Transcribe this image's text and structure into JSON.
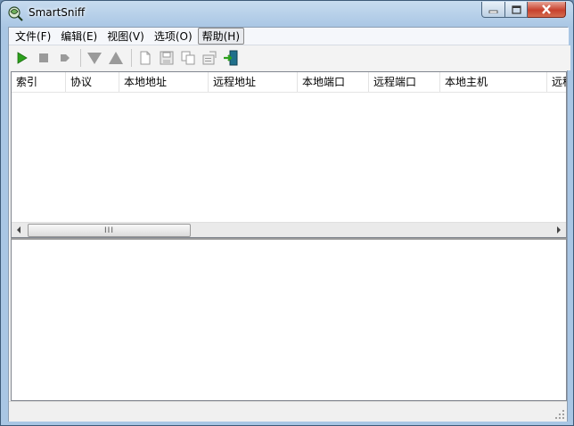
{
  "window": {
    "title": "SmartSniff",
    "controls": {
      "minimize": "minimize",
      "maximize": "maximize",
      "close": "close"
    }
  },
  "menu": {
    "items": [
      {
        "label": "文件(F)"
      },
      {
        "label": "编辑(E)"
      },
      {
        "label": "视图(V)"
      },
      {
        "label": "选项(O)"
      },
      {
        "label": "帮助(H)"
      }
    ]
  },
  "toolbar": {
    "buttons": [
      "start-capture-icon",
      "stop-capture-icon",
      "pause-icon",
      "filter-down-icon",
      "filter-up-icon",
      "new-document-icon",
      "save-icon",
      "copy-icon",
      "properties-icon",
      "exit-icon"
    ]
  },
  "table": {
    "columns": [
      {
        "label": "索引"
      },
      {
        "label": "协议"
      },
      {
        "label": "本地地址"
      },
      {
        "label": "远程地址"
      },
      {
        "label": "本地端口"
      },
      {
        "label": "远程端口"
      },
      {
        "label": "本地主机"
      },
      {
        "label": "远程主机"
      }
    ],
    "rows": [],
    "scroll_thumb_glyph": "III"
  },
  "colors": {
    "accent_green": "#2ca01c",
    "close_red": "#c7412d",
    "title_bar": "#b9d1ea"
  }
}
